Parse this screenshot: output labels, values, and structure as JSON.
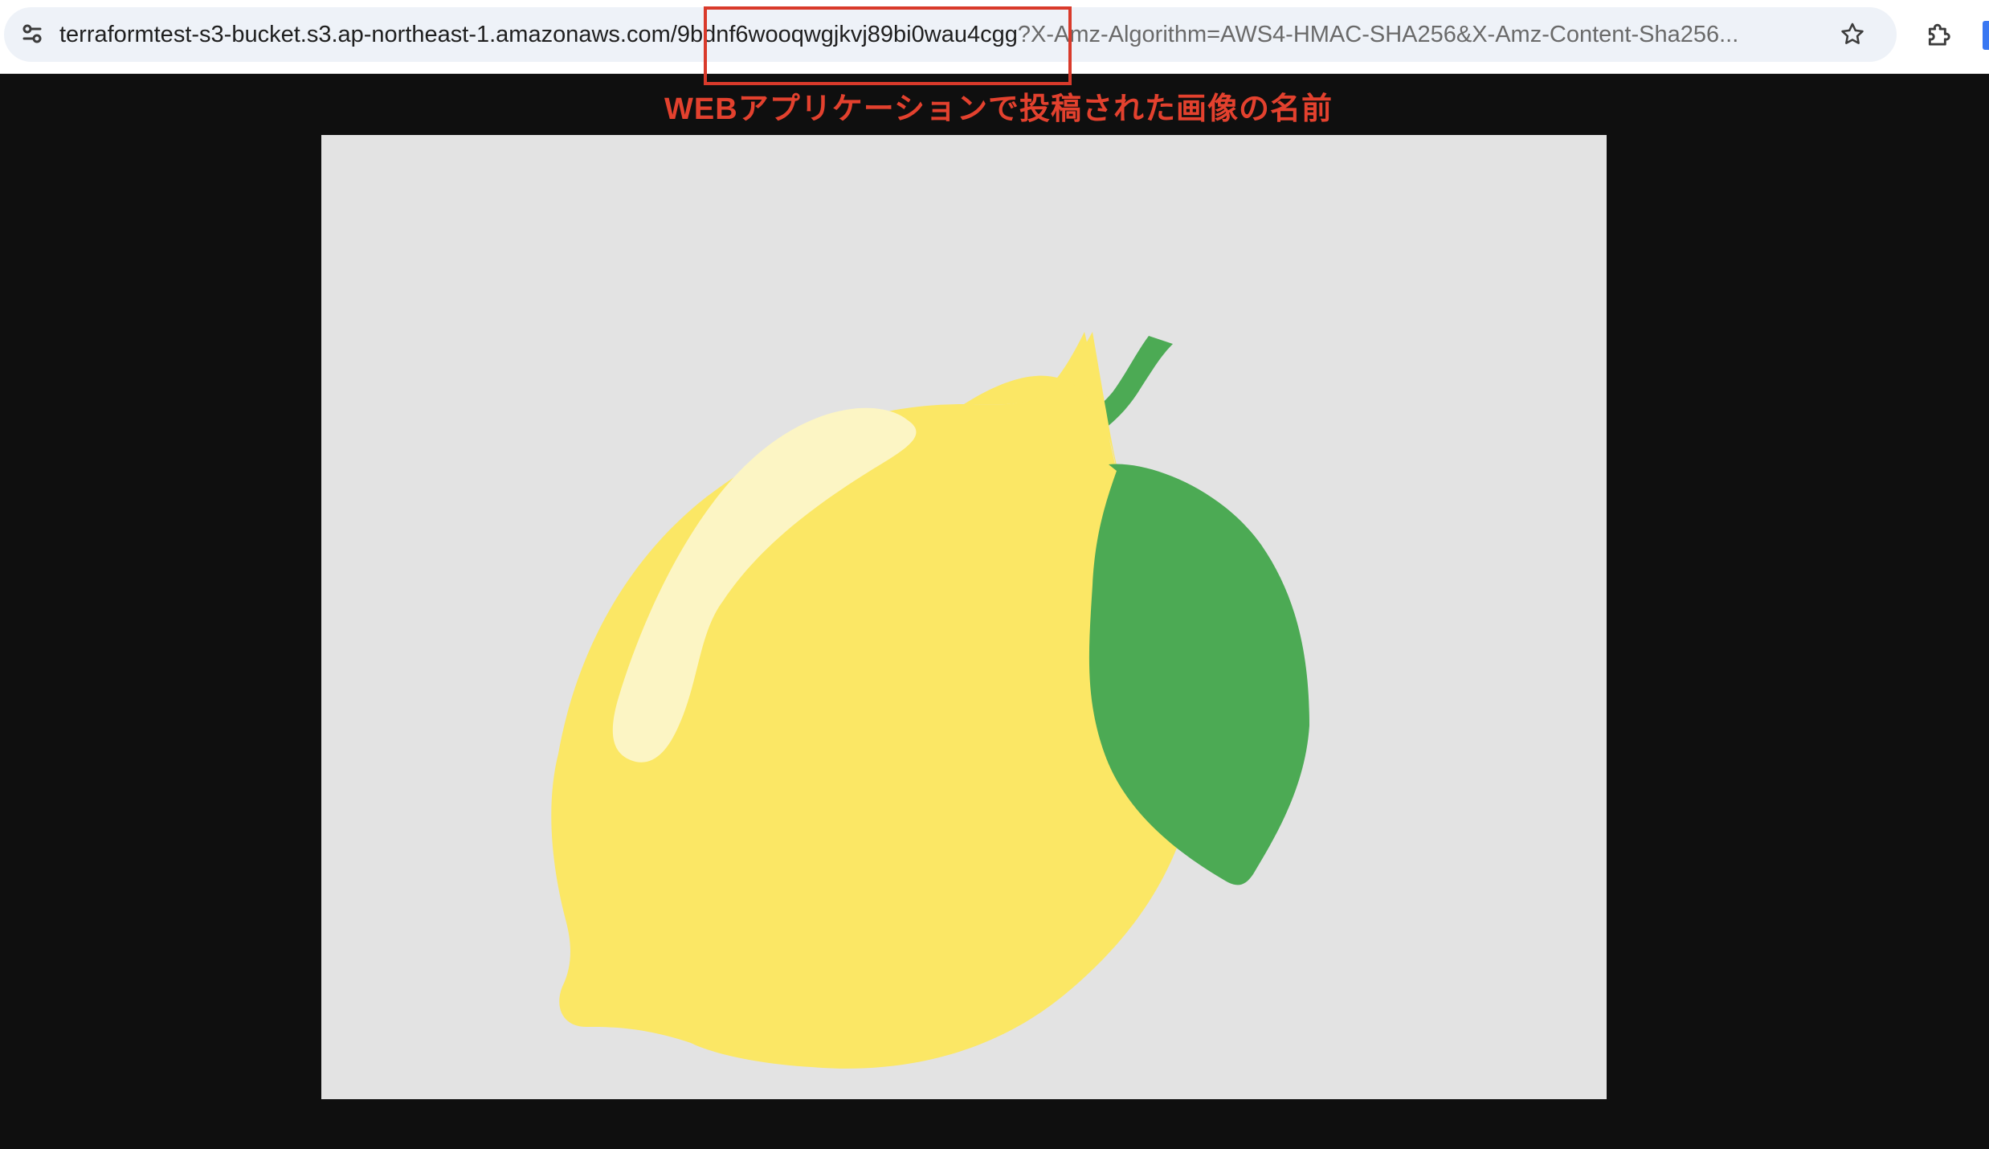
{
  "browser": {
    "url": {
      "host": "terraformtest-s3-bucket.s3.ap-northeast-1.amazonaws.com/",
      "object_key": "9bdnf6wooqwgjkvj89bi0wau4cgg",
      "query": "?X-Amz-Algorithm=AWS4-HMAC-SHA256&X-Amz-Content-Sha256..."
    },
    "icons": {
      "site_info": "tune-icon",
      "bookmark": "star-icon",
      "extensions": "puzzle-icon"
    }
  },
  "annotation": {
    "text": "WEBアプリケーションで投稿された画像の名前",
    "color": "#e3412e"
  },
  "image": {
    "subject": "lemon",
    "colors": {
      "background": "#e3e3e3",
      "lemon": "#fbe765",
      "highlight": "#fcf5c4",
      "leaf": "#4caa54"
    }
  }
}
